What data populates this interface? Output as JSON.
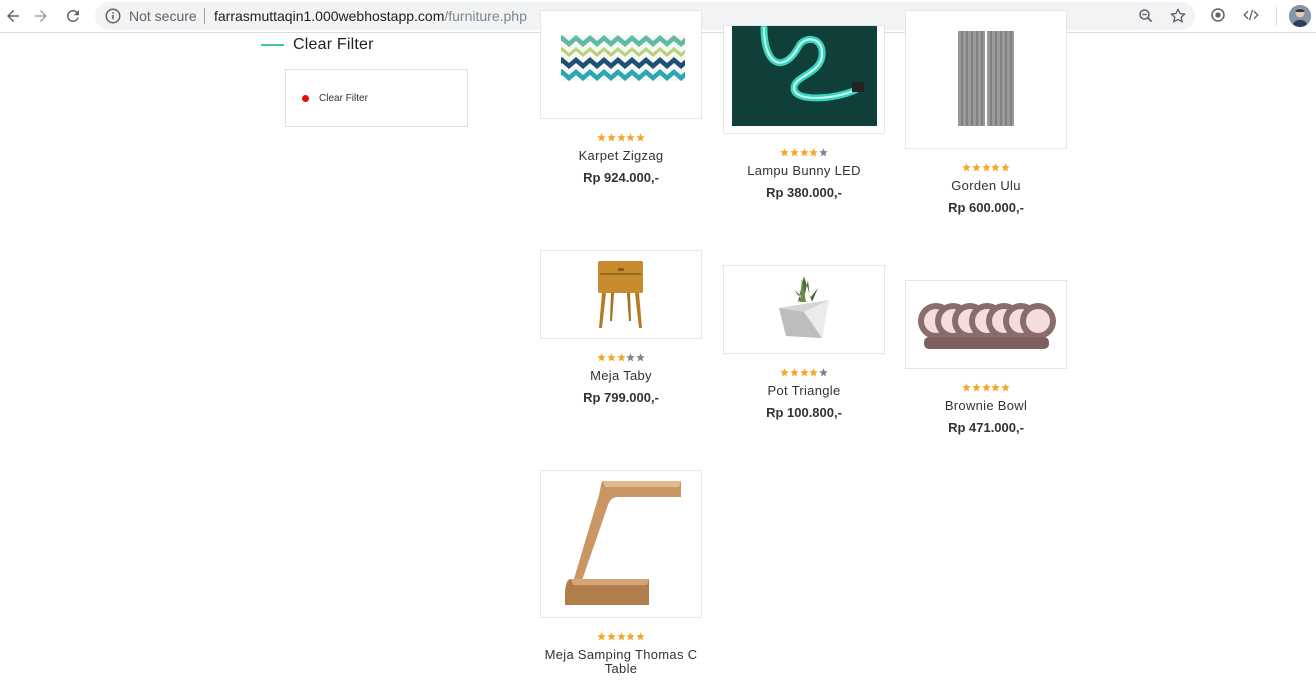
{
  "browser": {
    "security_label": "Not secure",
    "url_host": "farrasmuttaqin1.000webhostapp.com",
    "url_path": "/furniture.php"
  },
  "colors": {
    "accent": "#3ecf8e",
    "star_filled": "#f5a623",
    "star_empty": "#7b8494",
    "filter_dot": "#e01010"
  },
  "sidebar": {
    "heading": "Clear Filter",
    "items": [
      {
        "label": "Clear Filter"
      }
    ]
  },
  "products": [
    {
      "name": "Karpet Zigzag",
      "price": "Rp 924.000,-",
      "rating": 5,
      "image": "zigzag-carpet-image"
    },
    {
      "name": "Lampu Bunny LED",
      "price": "Rp 380.000,-",
      "rating": 4,
      "image": "neon-lamp-image"
    },
    {
      "name": "Gorden Ulu",
      "price": "Rp 600.000,-",
      "rating": 5,
      "image": "curtain-image"
    },
    {
      "name": "Meja Taby",
      "price": "Rp 799.000,-",
      "rating": 3,
      "image": "side-table-image"
    },
    {
      "name": "Pot Triangle",
      "price": "Rp 100.800,-",
      "rating": 4,
      "image": "plant-pot-image"
    },
    {
      "name": "Brownie Bowl",
      "price": "Rp 471.000,-",
      "rating": 5,
      "image": "bowls-image"
    },
    {
      "name": "Meja Samping Thomas C Table",
      "price": "",
      "rating": 5,
      "image": "c-table-image"
    }
  ]
}
